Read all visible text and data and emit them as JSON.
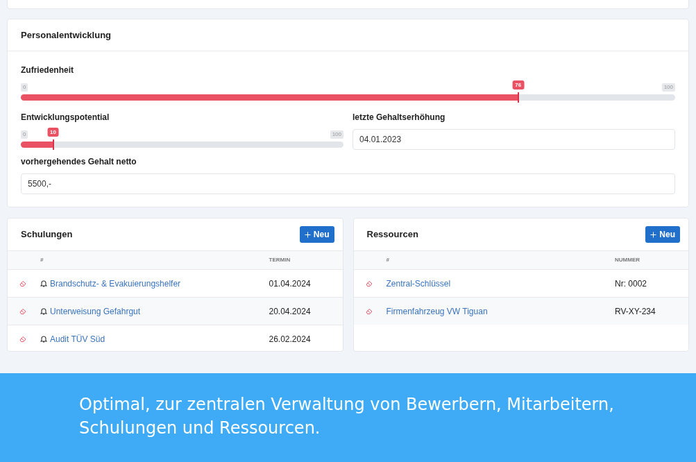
{
  "personal_development": {
    "title": "Personalentwicklung",
    "satisfaction": {
      "label": "Zufriedenheit",
      "min": "0",
      "max": "100",
      "value": "76",
      "level": 0.76
    },
    "potential": {
      "label": "Entwicklungspotential",
      "min": "0",
      "max": "100",
      "value": "10",
      "level": 0.1
    },
    "last_raise": {
      "label": "letzte Gehaltserhöhung",
      "value": "04.01.2023"
    },
    "previous_salary": {
      "label": "vorhergehendes Gehalt netto",
      "value": "5500,-"
    }
  },
  "tables": [
    {
      "title": "Schulungen",
      "button": "Neu",
      "columns": [
        "#",
        "TERMIN"
      ],
      "rows": [
        {
          "name": "Brandschutz- & Evakuierungshelfer",
          "value": "01.04.2024",
          "reminder": true
        },
        {
          "name": "Unterweisung Gefahrgut",
          "value": "20.04.2024",
          "reminder": true
        },
        {
          "name": "Audit TÜV Süd",
          "value": "26.02.2024",
          "reminder": true
        }
      ]
    },
    {
      "title": "Ressourcen",
      "button": "Neu",
      "columns": [
        "#",
        "NUMMER"
      ],
      "rows": [
        {
          "name": "Zentral-Schlüssel",
          "value": "Nr: 0002",
          "reminder": false
        },
        {
          "name": "Firmenfahrzeug VW Tiguan",
          "value": "RV-XY-234",
          "reminder": false
        }
      ]
    }
  ],
  "banner": {
    "text": "Optimal, zur zentralen Verwaltung von Bewerbern, Mitarbeitern, Schulungen und Ressourcen."
  }
}
